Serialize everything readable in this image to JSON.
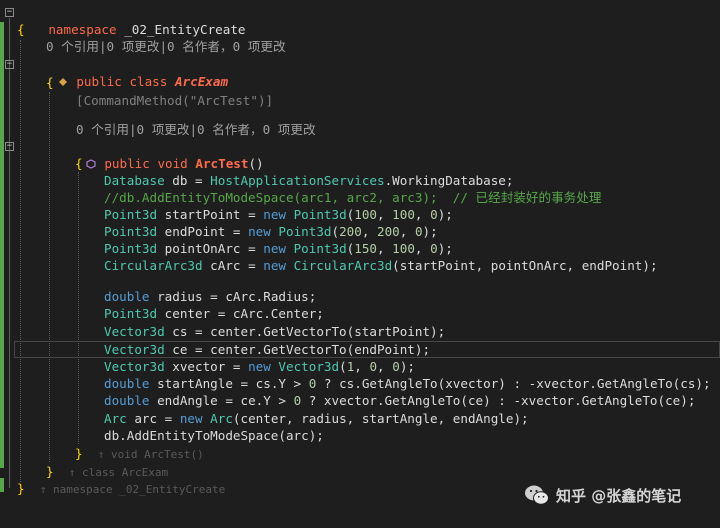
{
  "code": {
    "ns_kw": "namespace",
    "ns_name": "_02_EntityCreate",
    "lens1": "0 个引用|0 项更改|0 名作者，0 项更改",
    "cls_mod": "public",
    "cls_kw": "class",
    "cls_name": "ArcExam",
    "attr": "[CommandMethod(\"ArcTest\")]",
    "lens2": "0 个引用|0 项更改|0 名作者，0 项更改",
    "m_mod": "public",
    "m_void": "void",
    "m_name": "ArcTest",
    "m_parens": "()",
    "b1": "Database",
    "b1b": " db = ",
    "b1c": "HostApplicationServices",
    "b1d": ".WorkingDatabase;",
    "b2": "//db.AddEntityToModeSpace(arc1, arc2, arc3);  // 已经封装好的事务处理",
    "p1": "Point3d",
    "p1b": " startPoint = ",
    "p1c": "new",
    "p1d": " ",
    "p1e": "Point3d",
    "p1f": "(",
    "p1n1": "100",
    "p1n2": "100",
    "p1n3": "0",
    "p2": "Point3d",
    "p2b": " endPoint = ",
    "p2n1": "200",
    "p2n2": "200",
    "p2n3": "0",
    "p3": "Point3d",
    "p3b": " pointOnArc = ",
    "p3n1": "150",
    "p3n2": "100",
    "p3n3": "0",
    "c1": "CircularArc3d",
    "c1b": " cArc = ",
    "c1c": "CircularArc3d",
    "c1d": "(startPoint, pointOnArc, endPoint);",
    "d1": "double",
    "d1b": " radius = cArc.Radius;",
    "d2": "Point3d",
    "d2b": " center = cArc.Center;",
    "v1": "Vector3d",
    "v1b": " cs = center.GetVectorTo(startPoint);",
    "v2": "Vector3d",
    "v2b": " ce = center.GetVectorTo(endPoint);",
    "v3": "Vector3d",
    "v3b": " xvector = ",
    "v3c": "Vector3d",
    "v3n1": "1",
    "v3n2": "0",
    "v3n3": "0",
    "sa": "double",
    "sa_b": " startAngle = cs.Y > ",
    "sa_n": "0",
    "sa_c": " ? cs.GetAngleTo(xvector) : -xvector.GetAngleTo(cs);",
    "ea": "double",
    "ea_b": " endAngle = ce.Y > ",
    "ea_n": "0",
    "ea_c": " ? xvector.GetAngleTo(ce) : -xvector.GetAngleTo(ce);",
    "ar": "Arc",
    "ar_b": " arc = ",
    "ar_c": "Arc",
    "ar_d": "(center, radius, startAngle, endAngle);",
    "db": "db.AddEntityToModeSpace(arc);",
    "close_m": "}",
    "ghost_m": "void ArcTest()",
    "close_c": "}",
    "ghost_c": "class ArcExam",
    "close_n": "}",
    "ghost_n": "namespace _02_EntityCreate",
    "open": "{"
  },
  "watermark": {
    "text": "知乎 @张鑫的笔记"
  }
}
